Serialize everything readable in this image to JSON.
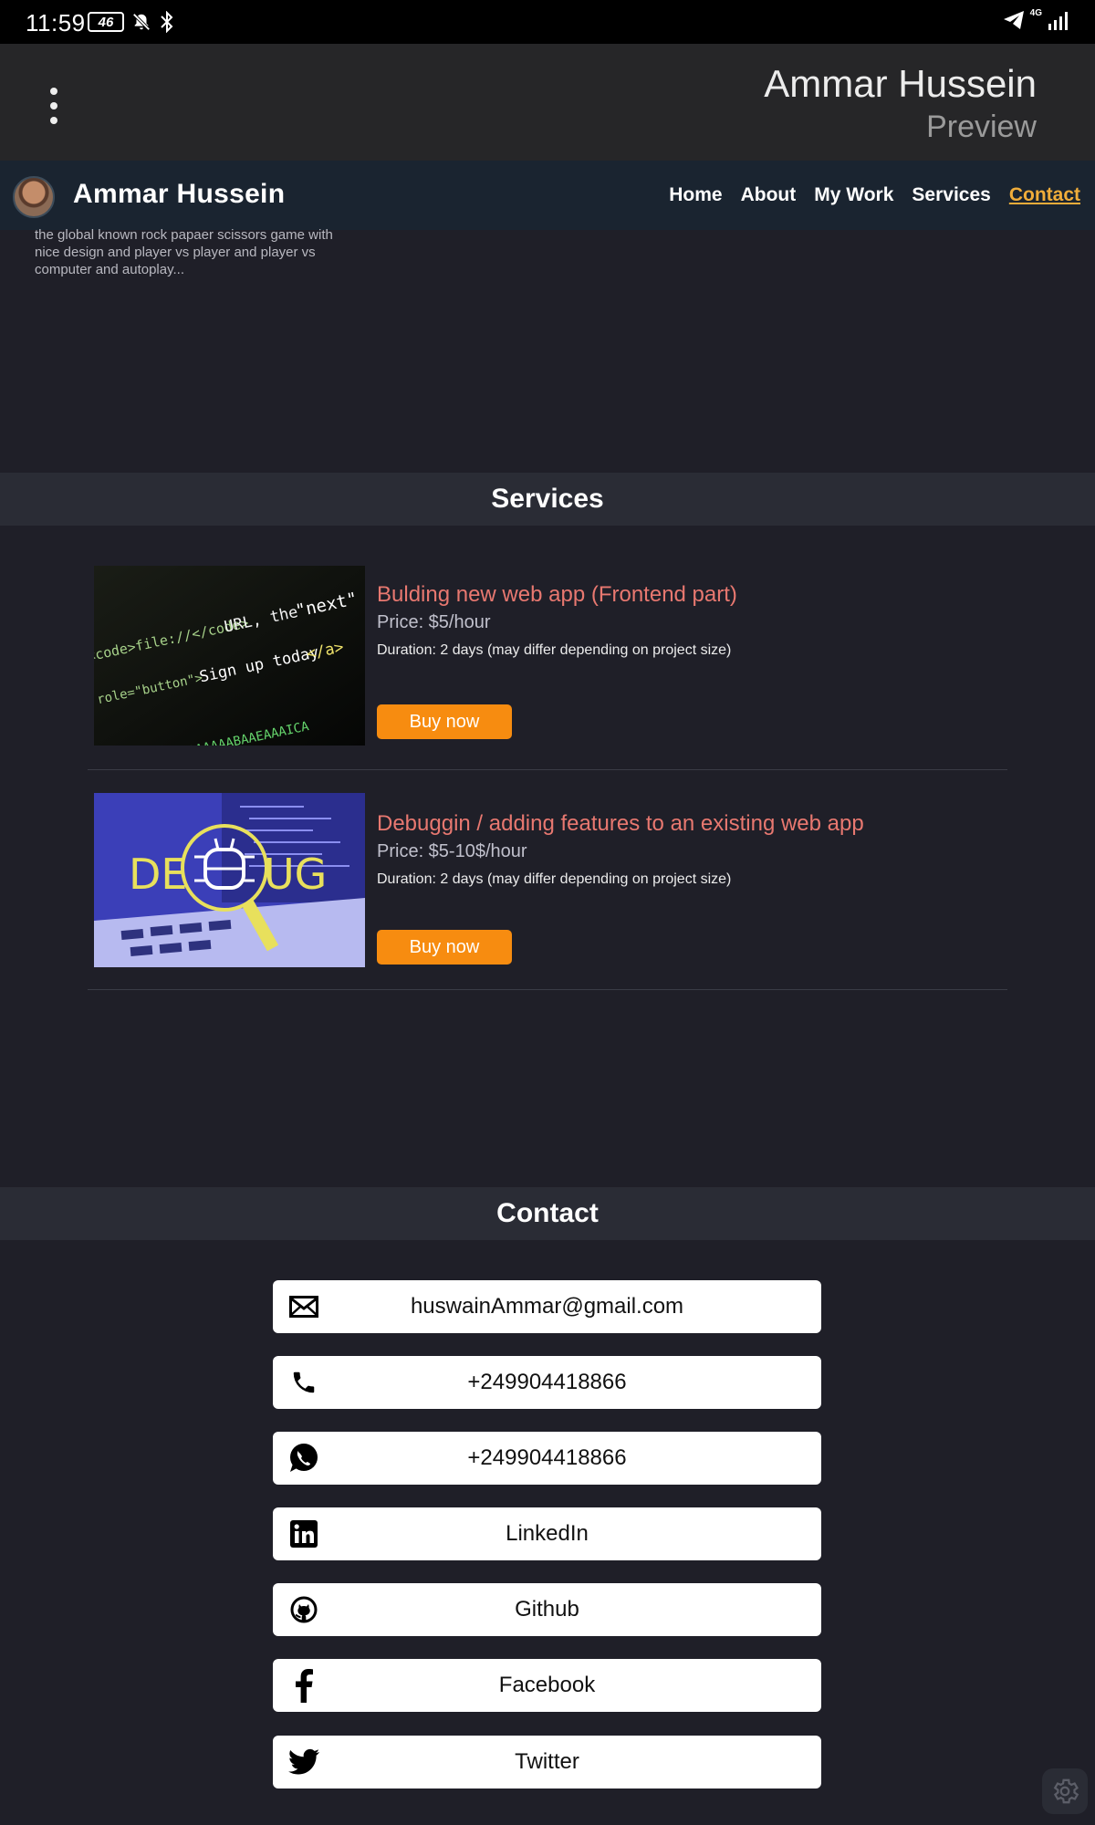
{
  "status_bar": {
    "time": "11:59",
    "battery": "46",
    "network": "4G"
  },
  "preview": {
    "title": "Ammar Hussein",
    "subtitle": "Preview"
  },
  "nav": {
    "site_name": "Ammar Hussein",
    "links": [
      {
        "label": "Home",
        "active": false
      },
      {
        "label": "About",
        "active": false
      },
      {
        "label": "My Work",
        "active": false
      },
      {
        "label": "Services",
        "active": false
      },
      {
        "label": "Contact",
        "active": true
      }
    ]
  },
  "work_snippet": {
    "text": "the global known rock papaer scissors game with nice design and player vs player and player vs computer and autoplay..."
  },
  "services": {
    "heading": "Services",
    "items": [
      {
        "title": "Bulding new web app (Frontend part)",
        "price": "Price: $5/hour",
        "duration": "Duration: 2 days (may differ depending on project size)",
        "button": "Buy now",
        "image": "code-screen-image"
      },
      {
        "title": "Debuggin / adding features to an existing web app",
        "price": "Price: $5-10$/hour",
        "duration": "Duration: 2 days (may differ depending on project size)",
        "button": "Buy now",
        "image": "debug-image"
      }
    ]
  },
  "contact": {
    "heading": "Contact",
    "items": [
      {
        "icon": "email-icon",
        "label": "huswainAmmar@gmail.com"
      },
      {
        "icon": "phone-icon",
        "label": "+249904418866"
      },
      {
        "icon": "whatsapp-icon",
        "label": "+249904418866"
      },
      {
        "icon": "linkedin-icon",
        "label": "LinkedIn"
      },
      {
        "icon": "github-icon",
        "label": "Github"
      },
      {
        "icon": "facebook-icon",
        "label": "Facebook"
      },
      {
        "icon": "twitter-icon",
        "label": "Twitter"
      }
    ]
  },
  "colors": {
    "accent_orange": "#f78c10",
    "title_red": "#e87870",
    "active_nav": "#f0ad3a",
    "background": "#1f1f28"
  }
}
